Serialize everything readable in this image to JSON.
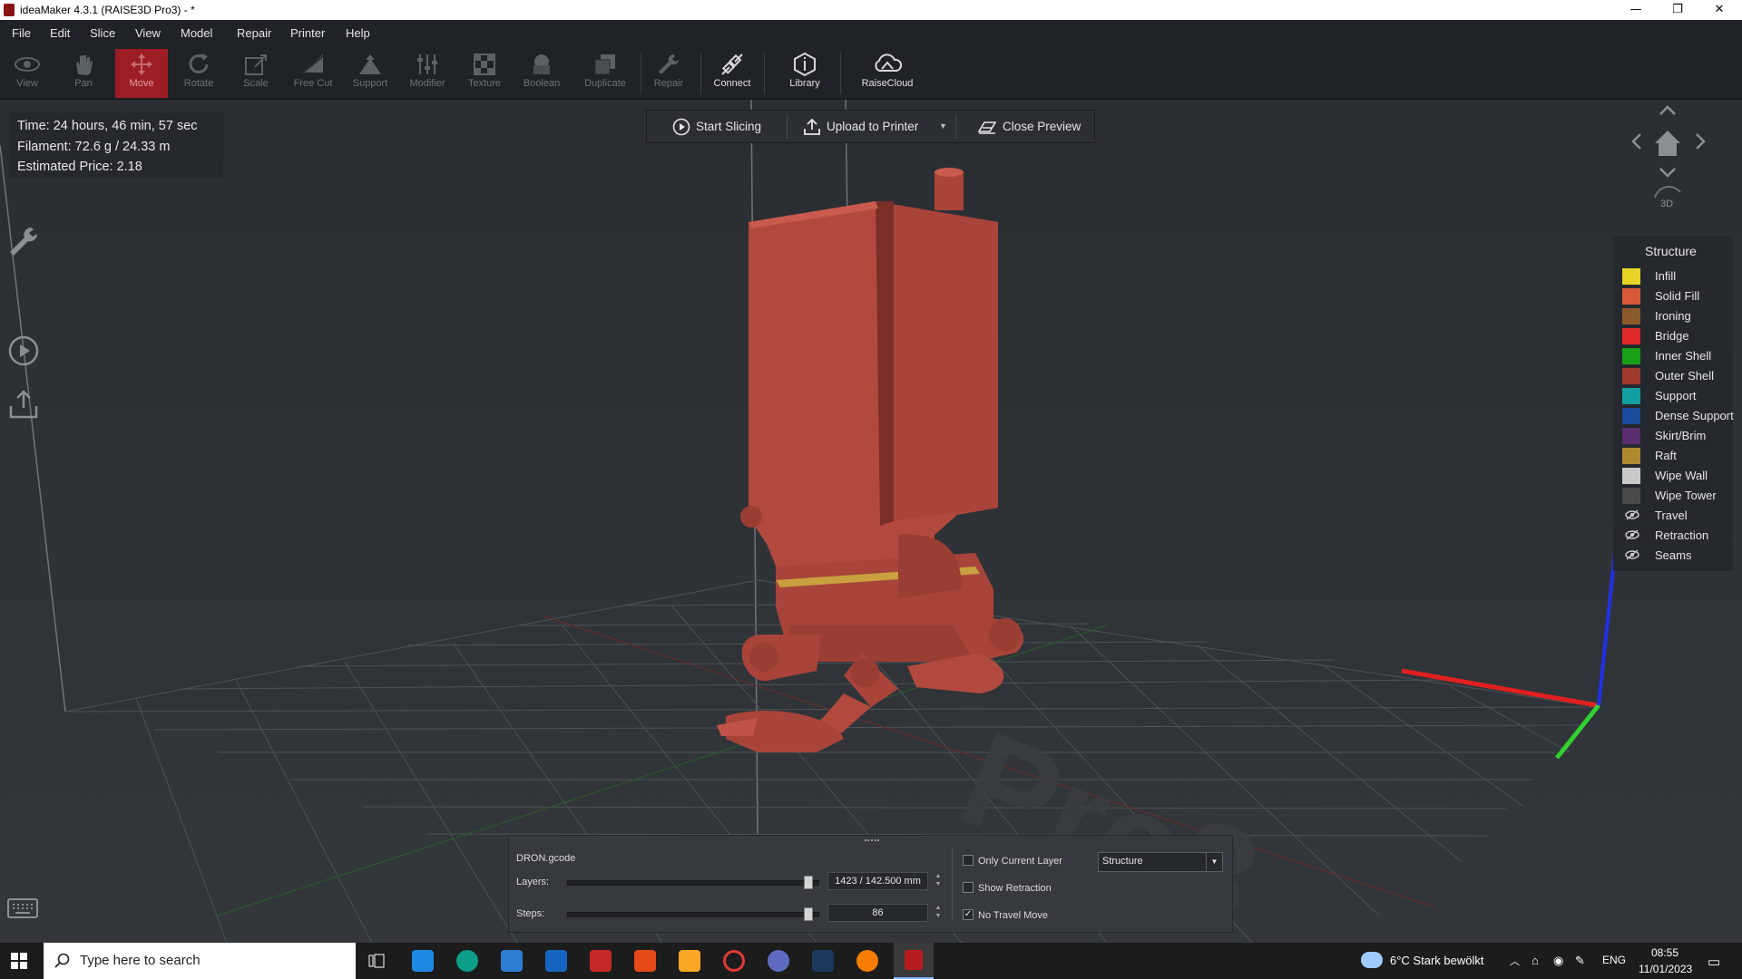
{
  "window": {
    "title": "ideaMaker 4.3.1 (RAISE3D Pro3) - *",
    "minimize": "—",
    "maximize": "❐",
    "close": "✕"
  },
  "menu": [
    "File",
    "Edit",
    "Slice",
    "View",
    "Model",
    "Repair",
    "Printer",
    "Help"
  ],
  "toolbar": [
    {
      "label": "View",
      "icon": "eye-icon",
      "enabled": false
    },
    {
      "label": "Pan",
      "icon": "hand-icon",
      "enabled": false
    },
    {
      "label": "Move",
      "icon": "move-icon",
      "enabled": false,
      "active": true
    },
    {
      "label": "Rotate",
      "icon": "rotate-icon",
      "enabled": false
    },
    {
      "label": "Scale",
      "icon": "scale-icon",
      "enabled": false
    },
    {
      "label": "Free Cut",
      "icon": "free-cut-icon",
      "enabled": false
    },
    {
      "label": "Support",
      "icon": "support-icon",
      "enabled": false
    },
    {
      "label": "Modifier",
      "icon": "modifier-icon",
      "enabled": false
    },
    {
      "label": "Texture",
      "icon": "texture-icon",
      "enabled": false
    },
    {
      "label": "Boolean",
      "icon": "boolean-icon",
      "enabled": false
    },
    {
      "label": "Duplicate",
      "icon": "duplicate-icon",
      "enabled": false
    },
    {
      "label": "Repair",
      "icon": "repair-icon",
      "enabled": false
    },
    {
      "label": "Connect",
      "icon": "connect-icon",
      "enabled": true
    },
    {
      "label": "Library",
      "icon": "library-icon",
      "enabled": true
    },
    {
      "label": "RaiseCloud",
      "icon": "cloud-icon",
      "enabled": true
    }
  ],
  "info": {
    "time": "Time: 24 hours, 46 min, 57 sec",
    "filament": "Filament: 72.6 g / 24.33 m",
    "price": "Estimated Price: 2.18"
  },
  "actions": {
    "start_slicing": "Start Slicing",
    "upload": "Upload to Printer",
    "close_preview": "Close Preview"
  },
  "navcube": {
    "label_3d": "3D"
  },
  "legend": {
    "title": "Structure",
    "items": [
      {
        "label": "Infill",
        "color": "#e8d426"
      },
      {
        "label": "Solid Fill",
        "color": "#d8593a"
      },
      {
        "label": "Ironing",
        "color": "#8a5a2a"
      },
      {
        "label": "Bridge",
        "color": "#e02a2a"
      },
      {
        "label": "Inner Shell",
        "color": "#18a018"
      },
      {
        "label": "Outer Shell",
        "color": "#9e3a2e"
      },
      {
        "label": "Support",
        "color": "#14a0a0"
      },
      {
        "label": "Dense Support",
        "color": "#1a4a9a"
      },
      {
        "label": "Skirt/Brim",
        "color": "#5a2e6e"
      },
      {
        "label": "Raft",
        "color": "#b08830"
      },
      {
        "label": "Wipe Wall",
        "color": "#c8c8c8"
      },
      {
        "label": "Wipe Tower",
        "color": "#4a4a4a"
      }
    ],
    "toggles": [
      {
        "label": "Travel",
        "icon": "eye-hidden-icon"
      },
      {
        "label": "Retraction",
        "icon": "eye-hidden-icon"
      },
      {
        "label": "Seams",
        "icon": "eye-hidden-icon"
      }
    ]
  },
  "preview": {
    "filename": "DRON.gcode",
    "layers_label": "Layers:",
    "layers_value": "1423 / 142.500 mm",
    "layers_fraction": 1.0,
    "steps_label": "Steps:",
    "steps_value": "86",
    "steps_fraction": 1.0,
    "only_current_layer": {
      "label": "Only Current Layer",
      "checked": false
    },
    "show_retraction": {
      "label": "Show Retraction",
      "checked": false
    },
    "no_travel_move": {
      "label": "No Travel Move",
      "checked": true
    },
    "view_mode": "Structure"
  },
  "taskbar": {
    "search_placeholder": "Type here to search",
    "weather": "6°C  Stark bewölkt",
    "language": "ENG",
    "time": "08:55",
    "date": "11/01/2023"
  },
  "colors": {
    "accent": "#9d1d24",
    "model": "#b2493f",
    "axis_x": "#e02020",
    "axis_y": "#30d030",
    "axis_z": "#2030e8"
  }
}
